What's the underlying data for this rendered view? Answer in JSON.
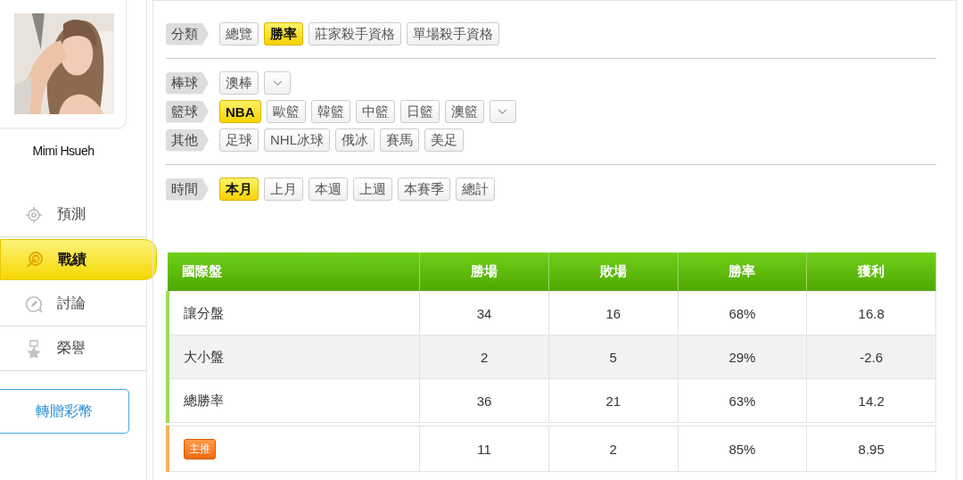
{
  "profile": {
    "name": "Mimi Hsueh"
  },
  "nav": [
    {
      "label": "預測",
      "selected": false
    },
    {
      "label": "戰績",
      "selected": true
    },
    {
      "label": "討論",
      "selected": false
    },
    {
      "label": "榮譽",
      "selected": false
    }
  ],
  "gift_button": "轉贈彩幣",
  "filter_groups": [
    {
      "rows": [
        {
          "label": "分類",
          "more": false,
          "options": [
            {
              "text": "總覽",
              "selected": false
            },
            {
              "text": "勝率",
              "selected": true
            },
            {
              "text": "莊家殺手資格",
              "selected": false
            },
            {
              "text": "單場殺手資格",
              "selected": false
            }
          ]
        }
      ]
    },
    {
      "rows": [
        {
          "label": "棒球",
          "more": true,
          "options": [
            {
              "text": "澳棒",
              "selected": false
            }
          ]
        },
        {
          "label": "籃球",
          "more": true,
          "options": [
            {
              "text": "NBA",
              "selected": true
            },
            {
              "text": "歐籃",
              "selected": false
            },
            {
              "text": "韓籃",
              "selected": false
            },
            {
              "text": "中籃",
              "selected": false
            },
            {
              "text": "日籃",
              "selected": false
            },
            {
              "text": "澳籃",
              "selected": false
            }
          ]
        },
        {
          "label": "其他",
          "more": false,
          "options": [
            {
              "text": "足球",
              "selected": false
            },
            {
              "text": "NHL冰球",
              "selected": false
            },
            {
              "text": "俄冰",
              "selected": false
            },
            {
              "text": "賽馬",
              "selected": false
            },
            {
              "text": "美足",
              "selected": false
            }
          ]
        }
      ]
    },
    {
      "rows": [
        {
          "label": "時間",
          "more": false,
          "options": [
            {
              "text": "本月",
              "selected": true
            },
            {
              "text": "上月",
              "selected": false
            },
            {
              "text": "本週",
              "selected": false
            },
            {
              "text": "上週",
              "selected": false
            },
            {
              "text": "本賽季",
              "selected": false
            },
            {
              "text": "總計",
              "selected": false
            }
          ]
        }
      ]
    }
  ],
  "table": {
    "columns": [
      "國際盤",
      "勝場",
      "敗場",
      "勝率",
      "獲利"
    ],
    "rows": [
      {
        "kind": "plain",
        "cells": [
          "讓分盤",
          "34",
          "16",
          "68%",
          "16.8"
        ]
      },
      {
        "kind": "plain",
        "cells": [
          "大小盤",
          "2",
          "5",
          "29%",
          "-2.6"
        ]
      },
      {
        "kind": "plain",
        "cells": [
          "總勝率",
          "36",
          "21",
          "63%",
          "14.2"
        ]
      },
      {
        "kind": "badge",
        "cells": [
          "主推",
          "11",
          "2",
          "85%",
          "8.95"
        ]
      }
    ]
  }
}
